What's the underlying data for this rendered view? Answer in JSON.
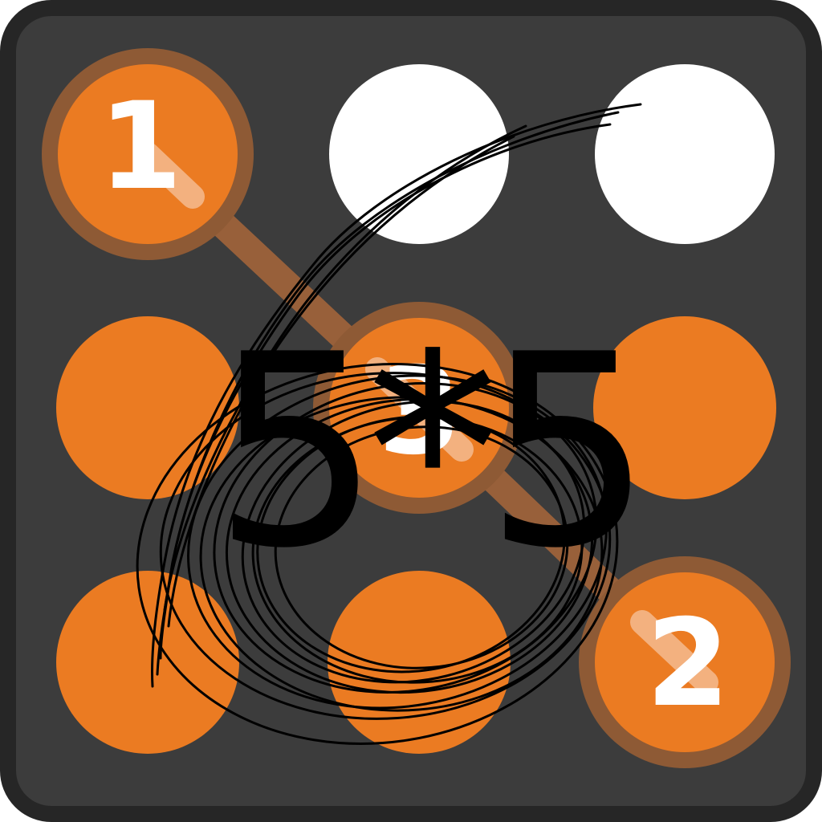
{
  "game": {
    "grid_size": 3,
    "cells": [
      {
        "id": "cell-1",
        "state": "selected",
        "label": "1"
      },
      {
        "id": "cell-2",
        "state": "empty",
        "label": ""
      },
      {
        "id": "cell-3",
        "state": "empty",
        "label": ""
      },
      {
        "id": "cell-4",
        "state": "filled",
        "label": ""
      },
      {
        "id": "cell-5",
        "state": "selected",
        "label": "3"
      },
      {
        "id": "cell-6",
        "state": "filled",
        "label": ""
      },
      {
        "id": "cell-7",
        "state": "filled",
        "label": ""
      },
      {
        "id": "cell-8",
        "state": "filled",
        "label": ""
      },
      {
        "id": "cell-9",
        "state": "selected",
        "label": "2"
      }
    ],
    "path_order": [
      "1",
      "3",
      "2"
    ],
    "problem_text": "5*5",
    "answer_scribble": "6"
  },
  "colors": {
    "frame_border": "#262626",
    "board_background": "#3c3c3c",
    "dot_orange": "#eb7b22",
    "dot_empty": "#ffffff",
    "path_line": "#a8663a",
    "ink": "#000000"
  }
}
